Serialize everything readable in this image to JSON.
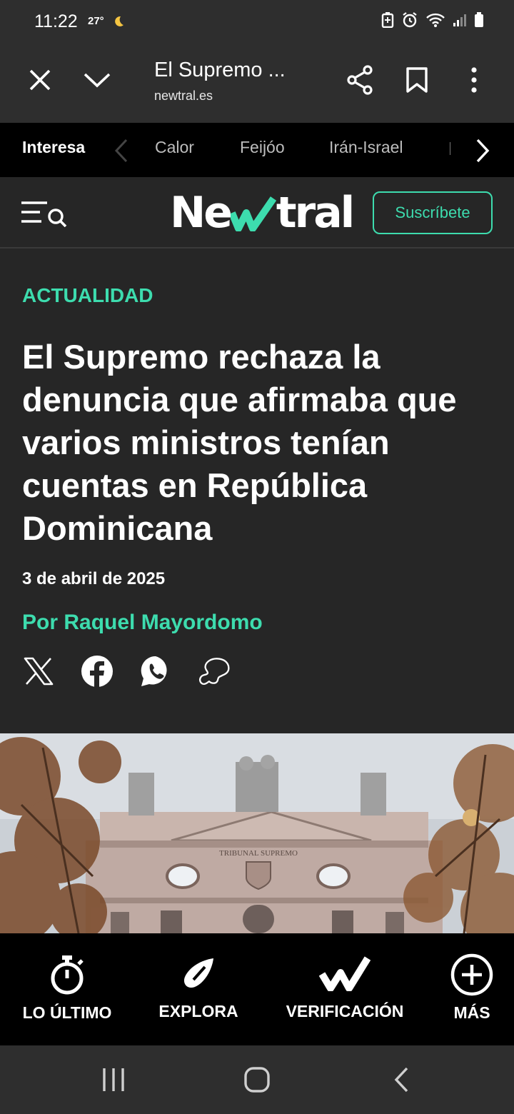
{
  "status_bar": {
    "time": "11:22",
    "temperature": "27°",
    "icons": [
      "moon-icon",
      "battery-saver-icon",
      "alarm-icon",
      "wifi-icon",
      "signal-icon",
      "battery-icon"
    ]
  },
  "browser": {
    "page_title": "El Supremo ...",
    "url": "newtral.es",
    "icons": [
      "close-icon",
      "chevron-down-icon",
      "share-icon",
      "bookmark-icon",
      "more-vert-icon"
    ]
  },
  "topics_bar": {
    "label": "Interesa",
    "items": [
      "Calor",
      "Feijóo",
      "Irán-Israel"
    ]
  },
  "site": {
    "logo_text": "Newtral",
    "subscribe_label": "Suscríbete",
    "accent_color": "#3ddcae"
  },
  "article": {
    "category": "ACTUALIDAD",
    "headline": "El Supremo rechaza la denuncia que afirmaba que varios ministros tenían cuentas en República Dominicana",
    "date": "3 de abril de 2025",
    "author": "Por Raquel Mayordomo",
    "share_icons": [
      "x-icon",
      "facebook-icon",
      "whatsapp-icon",
      "bluesky-icon"
    ],
    "photo_inscription": "TRIBUNAL SUPREMO"
  },
  "bottom_nav": {
    "items": [
      {
        "label": "LO ÚLTIMO",
        "icon": "stopwatch-icon"
      },
      {
        "label": "EXPLORA",
        "icon": "compass-icon"
      },
      {
        "label": "VERIFICACIÓN",
        "icon": "check-icon"
      },
      {
        "label": "MÁS",
        "icon": "plus-circle-icon"
      }
    ]
  },
  "system_nav": {
    "icons": [
      "recent-apps-icon",
      "home-icon",
      "back-icon"
    ]
  }
}
